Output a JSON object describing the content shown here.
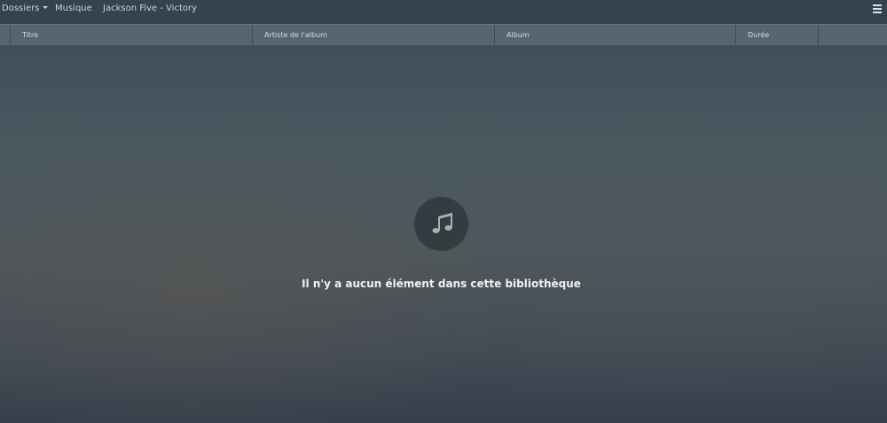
{
  "nav": {
    "folders_label": "Dossiers",
    "music_label": "Musique",
    "current_label": "Jackson Five - Victory"
  },
  "table": {
    "columns": [
      "",
      "Titre",
      "Artiste de l'album",
      "Album",
      "Durée",
      ""
    ]
  },
  "empty_state": {
    "icon": "music-note-icon",
    "message": "Il n'y a aucun élément dans cette bibliothèque"
  }
}
